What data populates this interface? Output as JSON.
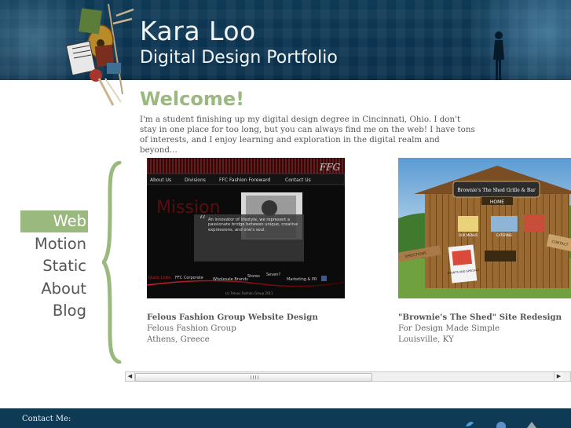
{
  "header": {
    "title": "Kara Loo",
    "subtitle": "Digital Design Portfolio"
  },
  "welcome": {
    "title": "Welcome!",
    "text": "I'm a student finishing up my digital design degree in Cincinnati, Ohio. I don't stay in one place for too long, but you can always find me on the web! I have tons of interests, and I enjoy learning and exploration in the digital realm and beyond..."
  },
  "nav": {
    "items": [
      {
        "label": "Web",
        "active": true
      },
      {
        "label": "Motion",
        "active": false
      },
      {
        "label": "Static",
        "active": false
      },
      {
        "label": "About",
        "active": false
      },
      {
        "label": "Blog",
        "active": false
      }
    ]
  },
  "projects": [
    {
      "name": "Felous Fashion Group Website Design",
      "client": "Felous Fashion Group",
      "location": "Athens, Greece",
      "thumb": {
        "nav": [
          "About Us",
          "Divisions",
          "FFC Fashion Foreward",
          "Contact Us"
        ],
        "logo": "FFG",
        "headline": "Mission",
        "quote": "An innovator of lifestyle, we represent a passionate bridge between unique, creative expressions, and one's soul.",
        "bottom_links": [
          "Quick Links",
          "FFC Corporate",
          "Wholesale Brands",
          "Stores",
          "Seven?",
          "Marketing & PR"
        ],
        "copyright": "(c) Felous Fashion Group 2011"
      }
    },
    {
      "name": "\"Brownie's The Shed\" Site Redesign",
      "client": "For Design Made Simple",
      "location": "Louisville, KY",
      "thumb": {
        "sign": "Brownie's The Shed Grille & Bar",
        "home": "HOME",
        "labels": [
          "OUR MENUS",
          "CATERING",
          "DIRECTIONS",
          "EVENTS AND SPECIALS",
          "CONTACT"
        ]
      }
    }
  ],
  "footer": {
    "contact_label": "Contact Me:"
  },
  "colors": {
    "header_bg": "#0f3a56",
    "accent_green": "#9ab97f",
    "text_gray": "#555555"
  }
}
